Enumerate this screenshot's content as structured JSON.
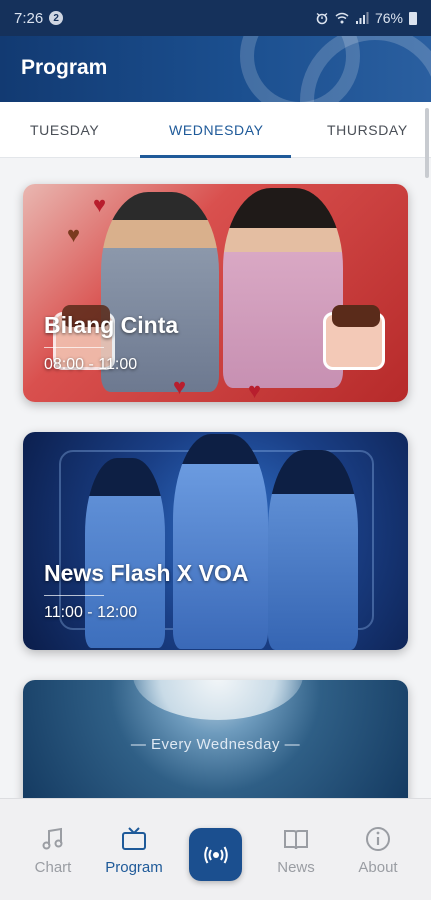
{
  "status_bar": {
    "time": "7:26",
    "notification_count": "2",
    "battery": "76%"
  },
  "app_bar": {
    "title": "Program"
  },
  "tabs": [
    {
      "label": "TUESDAY",
      "active": false
    },
    {
      "label": "WEDNESDAY",
      "active": true
    },
    {
      "label": "THURSDAY",
      "active": false
    }
  ],
  "programs": [
    {
      "title": "Bilang Cinta",
      "time": "08:00 - 11:00"
    },
    {
      "title": "News Flash X VOA",
      "time": "11:00 - 12:00"
    },
    {
      "banner_text": "— Every Wednesday —"
    }
  ],
  "bottom_nav": [
    {
      "label": "Chart",
      "icon": "music-note-icon",
      "active": false
    },
    {
      "label": "Program",
      "icon": "tv-icon",
      "active": true
    },
    {
      "label": "",
      "icon": "radio-broadcast-icon",
      "active": false
    },
    {
      "label": "News",
      "icon": "book-icon",
      "active": false
    },
    {
      "label": "About",
      "icon": "info-icon",
      "active": false
    }
  ],
  "colors": {
    "primary": "#1b4f8f",
    "active_text": "#1f5a99",
    "inactive_text": "#9a9da3"
  }
}
